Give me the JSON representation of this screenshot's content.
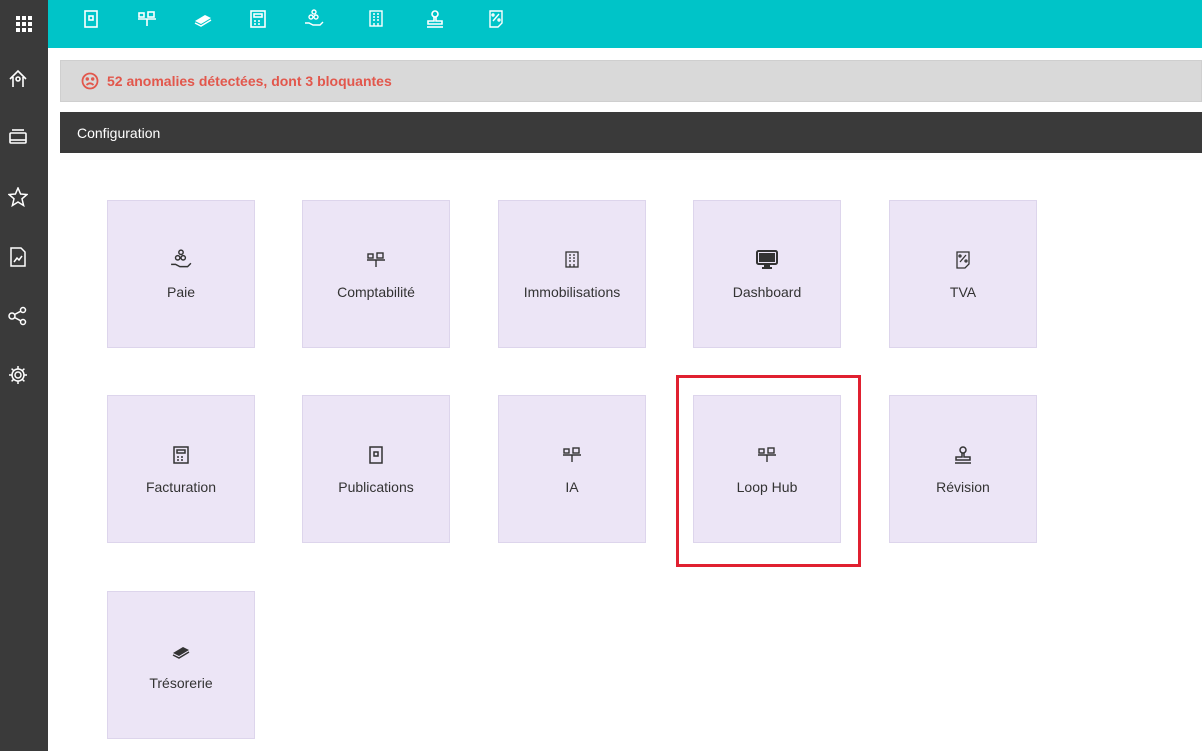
{
  "topbar": {
    "icons": [
      "apps-grid-icon",
      "publication-icon",
      "accounting-icon",
      "treasury-icon",
      "billing-calculator-icon",
      "payroll-icon",
      "building-icon",
      "stamp-icon",
      "vat-percent-icon"
    ]
  },
  "sidebar": {
    "icons": [
      "home-icon",
      "windows-icon",
      "star-icon",
      "report-icon",
      "share-icon",
      "settings-icon"
    ]
  },
  "alert": {
    "text": "52 anomalies détectées, dont 3 bloquantes",
    "icon": "sad-face-icon",
    "color": "#e2574c"
  },
  "section": {
    "title": "Configuration"
  },
  "tiles": [
    {
      "label": "Paie",
      "icon": "payroll-icon"
    },
    {
      "label": "Comptabilité",
      "icon": "accounting-icon"
    },
    {
      "label": "Immobilisations",
      "icon": "building-icon"
    },
    {
      "label": "Dashboard",
      "icon": "monitor-icon"
    },
    {
      "label": "TVA",
      "icon": "vat-percent-icon"
    },
    {
      "label": "Facturation",
      "icon": "billing-calculator-icon"
    },
    {
      "label": "Publications",
      "icon": "publication-icon"
    },
    {
      "label": "IA",
      "icon": "accounting-icon"
    },
    {
      "label": "Loop Hub",
      "icon": "accounting-icon"
    },
    {
      "label": "Révision",
      "icon": "stamp-icon"
    },
    {
      "label": "Trésorerie",
      "icon": "treasury-icon"
    }
  ],
  "colors": {
    "topbar": "#00c4c8",
    "sidebar": "#3a3a3a",
    "tile": "#ece5f6",
    "highlight": "#e02030"
  }
}
